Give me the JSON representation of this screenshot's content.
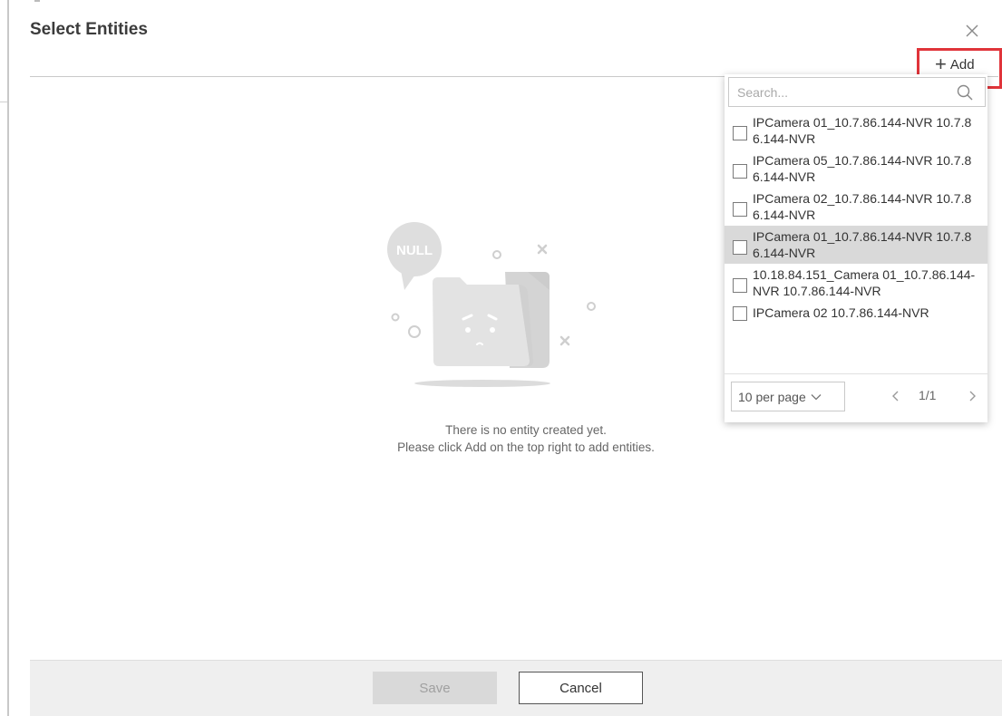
{
  "dialog": {
    "title": "Select Entities",
    "close_icon": "close-icon",
    "add_label": "Add",
    "add_icon": "plus-icon",
    "highlight_color": "#e0343a"
  },
  "empty_state": {
    "bubble_text": "NULL",
    "message_line1": "There is no entity created yet.",
    "message_line2": "Please click Add on the top right to add entities."
  },
  "dropdown": {
    "search_placeholder": "Search...",
    "search_value": "",
    "items": [
      {
        "label": "IPCamera 01_10.7.86.144-NVR 10.7.86.144-NVR",
        "checked": false,
        "hovered": false
      },
      {
        "label": "IPCamera 05_10.7.86.144-NVR 10.7.86.144-NVR",
        "checked": false,
        "hovered": false
      },
      {
        "label": "IPCamera 02_10.7.86.144-NVR 10.7.86.144-NVR",
        "checked": false,
        "hovered": false
      },
      {
        "label": "IPCamera 01_10.7.86.144-NVR 10.7.86.144-NVR",
        "checked": false,
        "hovered": true
      },
      {
        "label": "10.18.84.151_Camera 01_10.7.86.144-NVR 10.7.86.144-NVR",
        "checked": false,
        "hovered": false
      },
      {
        "label": "IPCamera 02 10.7.86.144-NVR",
        "checked": false,
        "hovered": false
      }
    ],
    "per_page": "10 per page",
    "page_indicator": "1/1"
  },
  "footer": {
    "save_label": "Save",
    "cancel_label": "Cancel"
  }
}
